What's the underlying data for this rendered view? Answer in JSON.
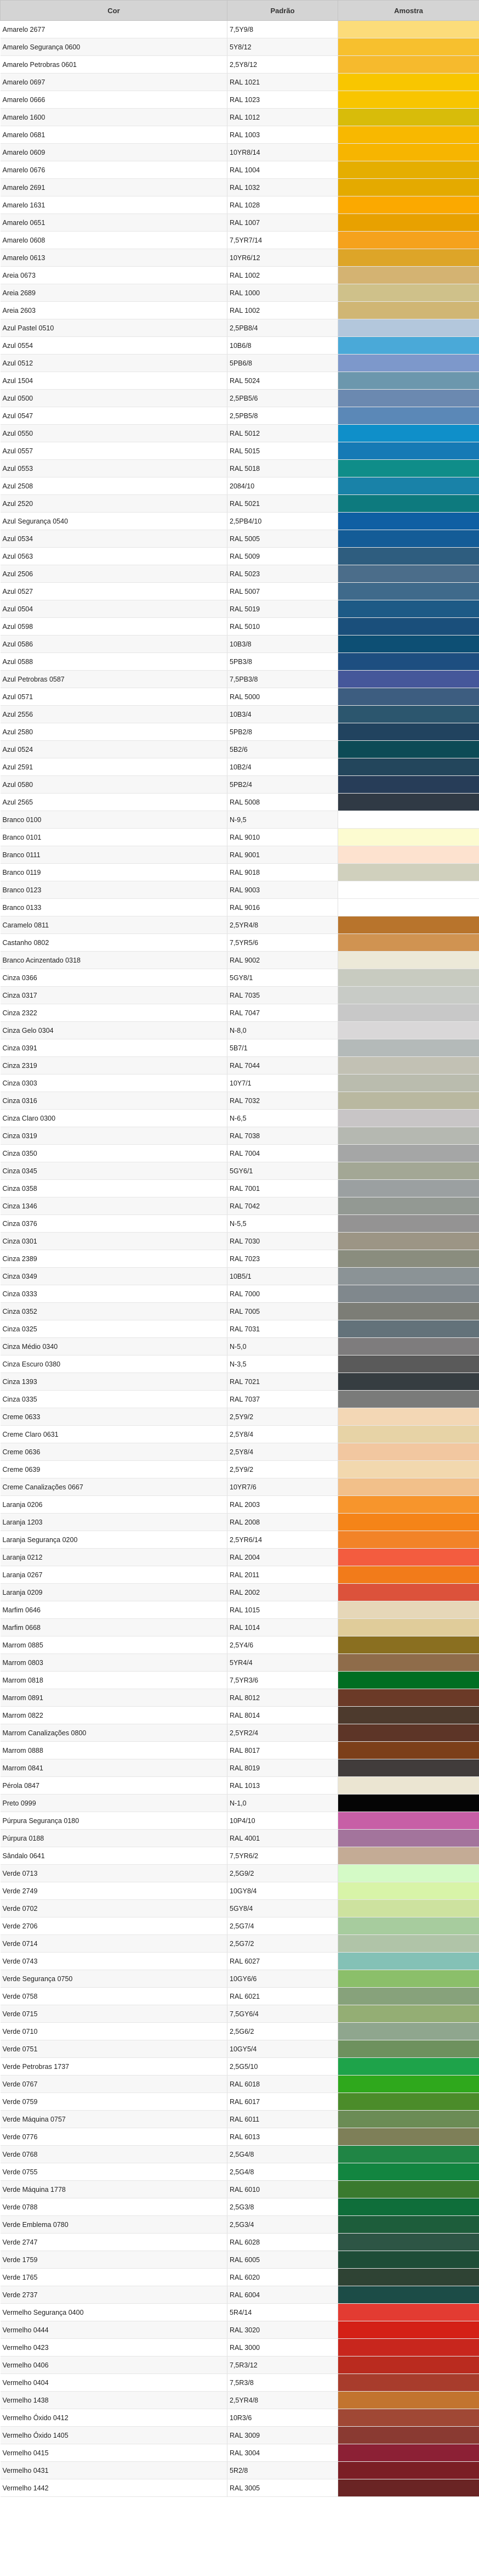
{
  "headers": {
    "cor": "Cor",
    "padrao": "Padrão",
    "amostra": "Amostra"
  },
  "rows": [
    {
      "cor": "Amarelo 2677",
      "padrao": "7,5Y9/8",
      "color": "#fcdc7a"
    },
    {
      "cor": "Amarelo Segurança 0600",
      "padrao": "5Y8/12",
      "color": "#f7c02e"
    },
    {
      "cor": "Amarelo Petrobras 0601",
      "padrao": "2,5Y8/12",
      "color": "#f6ba2d"
    },
    {
      "cor": "Amarelo 0697",
      "padrao": "RAL 1021",
      "color": "#f8c600"
    },
    {
      "cor": "Amarelo 0666",
      "padrao": "RAL 1023",
      "color": "#f8c500"
    },
    {
      "cor": "Amarelo 1600",
      "padrao": "RAL 1012",
      "color": "#d8bc0a"
    },
    {
      "cor": "Amarelo 0681",
      "padrao": "RAL 1003",
      "color": "#f8b800"
    },
    {
      "cor": "Amarelo 0609",
      "padrao": "10YR8/14",
      "color": "#f7b500"
    },
    {
      "cor": "Amarelo 0676",
      "padrao": "RAL 1004",
      "color": "#e5ae00"
    },
    {
      "cor": "Amarelo 2691",
      "padrao": "RAL 1032",
      "color": "#e4aa00"
    },
    {
      "cor": "Amarelo 1631",
      "padrao": "RAL 1028",
      "color": "#fba900"
    },
    {
      "cor": "Amarelo 0651",
      "padrao": "RAL 1007",
      "color": "#e8a100"
    },
    {
      "cor": "Amarelo 0608",
      "padrao": "7,5YR7/14",
      "color": "#f5a21c"
    },
    {
      "cor": "Amarelo 0613",
      "padrao": "10YR6/12",
      "color": "#dda528"
    },
    {
      "cor": "Areia 0673",
      "padrao": "RAL 1002",
      "color": "#d4b372"
    },
    {
      "cor": "Areia 2689",
      "padrao": "RAL 1000",
      "color": "#cfc18a"
    },
    {
      "cor": "Areia 2603",
      "padrao": "RAL 1002",
      "color": "#d0b674"
    },
    {
      "cor": "Azul Pastel 0510",
      "padrao": "2,5PB8/4",
      "color": "#b3c7dc"
    },
    {
      "cor": "Azul 0554",
      "padrao": "10B6/8",
      "color": "#4aa9d8"
    },
    {
      "cor": "Azul 0512",
      "padrao": "5PB6/8",
      "color": "#7d98cb"
    },
    {
      "cor": "Azul 1504",
      "padrao": "RAL 5024",
      "color": "#6c97ad"
    },
    {
      "cor": "Azul 0500",
      "padrao": "2,5PB5/6",
      "color": "#6b89b0"
    },
    {
      "cor": "Azul 0547",
      "padrao": "2,5PB5/8",
      "color": "#5b88b7"
    },
    {
      "cor": "Azul 0550",
      "padrao": "RAL 5012",
      "color": "#0f8fc9"
    },
    {
      "cor": "Azul 0557",
      "padrao": "RAL 5015",
      "color": "#167ab5"
    },
    {
      "cor": "Azul 0553",
      "padrao": "RAL 5018",
      "color": "#0f8d89"
    },
    {
      "cor": "Azul 2508",
      "padrao": "2084/10",
      "color": "#1982a8"
    },
    {
      "cor": "Azul 2520",
      "padrao": "RAL 5021",
      "color": "#0d7a7e"
    },
    {
      "cor": "Azul Segurança 0540",
      "padrao": "2,5PB4/10",
      "color": "#0f5fa3"
    },
    {
      "cor": "Azul 0534",
      "padrao": "RAL 5005",
      "color": "#145c97"
    },
    {
      "cor": "Azul 0563",
      "padrao": "RAL 5009",
      "color": "#2e5d7f"
    },
    {
      "cor": "Azul 2506",
      "padrao": "RAL 5023",
      "color": "#4b6d8a"
    },
    {
      "cor": "Azul 0527",
      "padrao": "RAL 5007",
      "color": "#3f6a8b"
    },
    {
      "cor": "Azul 0504",
      "padrao": "RAL 5019",
      "color": "#1d5a86"
    },
    {
      "cor": "Azul 0598",
      "padrao": "RAL 5010",
      "color": "#1a4f7b"
    },
    {
      "cor": "Azul 0586",
      "padrao": "10B3/8",
      "color": "#0d4f74"
    },
    {
      "cor": "Azul 0588",
      "padrao": "5PB3/8",
      "color": "#1d4e80"
    },
    {
      "cor": "Azul Petrobras 0587",
      "padrao": "7,5PB3/8",
      "color": "#45579a"
    },
    {
      "cor": "Azul 0571",
      "padrao": "RAL 5000",
      "color": "#3d5d80"
    },
    {
      "cor": "Azul 2556",
      "padrao": "10B3/4",
      "color": "#2c566e"
    },
    {
      "cor": "Azul 2580",
      "padrao": "5PB2/8",
      "color": "#21435f"
    },
    {
      "cor": "Azul 0524",
      "padrao": "5B2/6",
      "color": "#0d4b56"
    },
    {
      "cor": "Azul 2591",
      "padrao": "10B2/4",
      "color": "#23465c"
    },
    {
      "cor": "Azul 0580",
      "padrao": "5PB2/4",
      "color": "#273d58"
    },
    {
      "cor": "Azul 2565",
      "padrao": "RAL 5008",
      "color": "#303a45"
    },
    {
      "cor": "Branco 0100",
      "padrao": "N-9,5",
      "color": "#ffffff"
    },
    {
      "cor": "Branco 0101",
      "padrao": "RAL 9010",
      "color": "#fcfbd0"
    },
    {
      "cor": "Branco 0111",
      "padrao": "RAL 9001",
      "color": "#fde2cf"
    },
    {
      "cor": "Branco 0119",
      "padrao": "RAL 9018",
      "color": "#d0d0bd"
    },
    {
      "cor": "Branco 0123",
      "padrao": "RAL 9003",
      "color": "#ffffff"
    },
    {
      "cor": "Branco 0133",
      "padrao": "RAL 9016",
      "color": "#ffffff"
    },
    {
      "cor": "Caramelo 0811",
      "padrao": "2,5YR4/8",
      "color": "#b8742c"
    },
    {
      "cor": "Castanho 0802",
      "padrao": "7,5YR5/6",
      "color": "#d09351"
    },
    {
      "cor": "Branco Acinzentado 0318",
      "padrao": "RAL 9002",
      "color": "#ece9d8"
    },
    {
      "cor": "Cinza 0366",
      "padrao": "5GY8/1",
      "color": "#c8cbc0"
    },
    {
      "cor": "Cinza 0317",
      "padrao": "RAL 7035",
      "color": "#c8cbc6"
    },
    {
      "cor": "Cinza 2322",
      "padrao": "RAL 7047",
      "color": "#c8c8c8"
    },
    {
      "cor": "Cinza Gelo 0304",
      "padrao": "N-8,0",
      "color": "#d9d7d8"
    },
    {
      "cor": "Cinza 0391",
      "padrao": "5B7/1",
      "color": "#b4bab9"
    },
    {
      "cor": "Cinza 2319",
      "padrao": "RAL 7044",
      "color": "#c2c1b4"
    },
    {
      "cor": "Cinza 0303",
      "padrao": "10Y7/1",
      "color": "#babcae"
    },
    {
      "cor": "Cinza 0316",
      "padrao": "RAL 7032",
      "color": "#b9b8a0"
    },
    {
      "cor": "Cinza Claro 0300",
      "padrao": "N-6,5",
      "color": "#c8c5c6"
    },
    {
      "cor": "Cinza 0319",
      "padrao": "RAL 7038",
      "color": "#b5b8b1"
    },
    {
      "cor": "Cinza 0350",
      "padrao": "RAL 7004",
      "color": "#a5a6a6"
    },
    {
      "cor": "Cinza 0345",
      "padrao": "5GY6/1",
      "color": "#a3a795"
    },
    {
      "cor": "Cinza 0358",
      "padrao": "RAL 7001",
      "color": "#9ba0a1"
    },
    {
      "cor": "Cinza 1346",
      "padrao": "RAL 7042",
      "color": "#939993"
    },
    {
      "cor": "Cinza 0376",
      "padrao": "N-5,5",
      "color": "#949393"
    },
    {
      "cor": "Cinza 0301",
      "padrao": "RAL 7030",
      "color": "#9c9585"
    },
    {
      "cor": "Cinza 2389",
      "padrao": "RAL 7023",
      "color": "#8a8d7e"
    },
    {
      "cor": "Cinza 0349",
      "padrao": "10B5/1",
      "color": "#8b9396"
    },
    {
      "cor": "Cinza 0333",
      "padrao": "RAL 7000",
      "color": "#80888d"
    },
    {
      "cor": "Cinza 0352",
      "padrao": "RAL 7005",
      "color": "#7c7d76"
    },
    {
      "cor": "Cinza 0325",
      "padrao": "RAL 7031",
      "color": "#63727a"
    },
    {
      "cor": "Cinza Médio 0340",
      "padrao": "N-5,0",
      "color": "#7e7c7d"
    },
    {
      "cor": "Cinza Escuro 0380",
      "padrao": "N-3,5",
      "color": "#5a5a5a"
    },
    {
      "cor": "Cinza 1393",
      "padrao": "RAL 7021",
      "color": "#363d41"
    },
    {
      "cor": "Cinza 0335",
      "padrao": "RAL 7037",
      "color": "#7a7b7a"
    },
    {
      "cor": "Creme 0633",
      "padrao": "2,5Y9/2",
      "color": "#f3d7b5"
    },
    {
      "cor": "Creme Claro 0631",
      "padrao": "2,5Y8/4",
      "color": "#e7d3a6"
    },
    {
      "cor": "Creme 0636",
      "padrao": "2,5Y8/4",
      "color": "#f2c7a0"
    },
    {
      "cor": "Creme 0639",
      "padrao": "2,5Y9/2",
      "color": "#f2d8ae"
    },
    {
      "cor": "Creme Canalizações 0667",
      "padrao": "10YR7/6",
      "color": "#f2c08a"
    },
    {
      "cor": "Laranja 0206",
      "padrao": "RAL 2003",
      "color": "#f7952c"
    },
    {
      "cor": "Laranja 1203",
      "padrao": "RAL 2008",
      "color": "#f58418"
    },
    {
      "cor": "Laranja Segurança 0200",
      "padrao": "2,5YR6/14",
      "color": "#f28328"
    },
    {
      "cor": "Laranja 0212",
      "padrao": "RAL 2004",
      "color": "#f35c3f"
    },
    {
      "cor": "Laranja 0267",
      "padrao": "RAL 2011",
      "color": "#f27b1a"
    },
    {
      "cor": "Laranja 0209",
      "padrao": "RAL 2002",
      "color": "#dc523b"
    },
    {
      "cor": "Marfim 0646",
      "padrao": "RAL 1015",
      "color": "#e6d7b8"
    },
    {
      "cor": "Marfim 0668",
      "padrao": "RAL 1014",
      "color": "#e0cc9a"
    },
    {
      "cor": "Marrom 0885",
      "padrao": "2,5Y4/6",
      "color": "#8a6f20"
    },
    {
      "cor": "Marrom 0803",
      "padrao": "5YR4/4",
      "color": "#8f6c4a"
    },
    {
      "cor": "Marrom 0818",
      "padrao": "7,5YR3/6",
      "color": "#006e22"
    },
    {
      "cor": "Marrom 0891",
      "padrao": "RAL 8012",
      "color": "#6b3a27"
    },
    {
      "cor": "Marrom 0822",
      "padrao": "RAL 8014",
      "color": "#4d3a2d"
    },
    {
      "cor": "Marrom Canalizações 0800",
      "padrao": "2,5YR2/4",
      "color": "#5d3527"
    },
    {
      "cor": "Marrom 0888",
      "padrao": "RAL 8017",
      "color": "#7c3f19"
    },
    {
      "cor": "Marrom 0841",
      "padrao": "RAL 8019",
      "color": "#413c3b"
    },
    {
      "cor": "Pérola 0847",
      "padrao": "RAL 1013",
      "color": "#ebe5d2"
    },
    {
      "cor": "Preto 0999",
      "padrao": "N-1,0",
      "color": "#050505"
    },
    {
      "cor": "Púrpura Segurança 0180",
      "padrao": "10P4/10",
      "color": "#c75fa6"
    },
    {
      "cor": "Púrpura 0188",
      "padrao": "RAL 4001",
      "color": "#a3749c"
    },
    {
      "cor": "Sândalo 0641",
      "padrao": "7,5YR6/2",
      "color": "#c4ab95"
    },
    {
      "cor": "Verde 0713",
      "padrao": "2,5G9/2",
      "color": "#d4fac6"
    },
    {
      "cor": "Verde 2749",
      "padrao": "10GY8/4",
      "color": "#d8f4a8"
    },
    {
      "cor": "Verde 0702",
      "padrao": "5GY8/4",
      "color": "#cde29f"
    },
    {
      "cor": "Verde 2706",
      "padrao": "2,5G7/4",
      "color": "#a7cc9e"
    },
    {
      "cor": "Verde 0714",
      "padrao": "2,5G7/2",
      "color": "#b0c4a8"
    },
    {
      "cor": "Verde 0743",
      "padrao": "RAL 6027",
      "color": "#84c1b6"
    },
    {
      "cor": "Verde Segurança 0750",
      "padrao": "10GY6/6",
      "color": "#8bbf6a"
    },
    {
      "cor": "Verde 0758",
      "padrao": "RAL 6021",
      "color": "#87a27b"
    },
    {
      "cor": "Verde 0715",
      "padrao": "7,5GY6/4",
      "color": "#94ae74"
    },
    {
      "cor": "Verde 0710",
      "padrao": "2,5G6/2",
      "color": "#8fa68e"
    },
    {
      "cor": "Verde 0751",
      "padrao": "10GY5/4",
      "color": "#6e915e"
    },
    {
      "cor": "Verde Petrobras 1737",
      "padrao": "2,5G5/10",
      "color": "#1ea34a"
    },
    {
      "cor": "Verde 0767",
      "padrao": "RAL 6018",
      "color": "#2fa81c"
    },
    {
      "cor": "Verde 0759",
      "padrao": "RAL 6017",
      "color": "#4b8c2a"
    },
    {
      "cor": "Verde Máquina 0757",
      "padrao": "RAL 6011",
      "color": "#6b8c55"
    },
    {
      "cor": "Verde 0776",
      "padrao": "RAL 6013",
      "color": "#7e7f58"
    },
    {
      "cor": "Verde 0768",
      "padrao": "2,5G4/8",
      "color": "#208545"
    },
    {
      "cor": "Verde 0755",
      "padrao": "2,5G4/8",
      "color": "#128540"
    },
    {
      "cor": "Verde Máquina 1778",
      "padrao": "RAL 6010",
      "color": "#3a7a2e"
    },
    {
      "cor": "Verde 0788",
      "padrao": "2,5G3/8",
      "color": "#0f6e3a"
    },
    {
      "cor": "Verde Emblema 0780",
      "padrao": "2,5G3/4",
      "color": "#1d5d3b"
    },
    {
      "cor": "Verde 2747",
      "padrao": "RAL 6028",
      "color": "#2d5545"
    },
    {
      "cor": "Verde 1759",
      "padrao": "RAL 6005",
      "color": "#1e4d37"
    },
    {
      "cor": "Verde 1765",
      "padrao": "RAL 6020",
      "color": "#2f4334"
    },
    {
      "cor": "Verde 2737",
      "padrao": "RAL 6004",
      "color": "#1c4c47"
    },
    {
      "cor": "Vermelho Segurança 0400",
      "padrao": "5R4/14",
      "color": "#e33b32"
    },
    {
      "cor": "Vermelho 0444",
      "padrao": "RAL 3020",
      "color": "#d42016"
    },
    {
      "cor": "Vermelho 0423",
      "padrao": "RAL 3000",
      "color": "#c8261d"
    },
    {
      "cor": "Vermelho 0406",
      "padrao": "7,5R3/12",
      "color": "#ba2b1f"
    },
    {
      "cor": "Vermelho 0404",
      "padrao": "7,5R3/8",
      "color": "#a83c2c"
    },
    {
      "cor": "Vermelho 1438",
      "padrao": "2,5YR4/8",
      "color": "#c2742f"
    },
    {
      "cor": "Vermelho Óxido 0412",
      "padrao": "10R3/6",
      "color": "#a04835"
    },
    {
      "cor": "Vermelho Óxido 1405",
      "padrao": "RAL 3009",
      "color": "#8a3a32"
    },
    {
      "cor": "Vermelho 0415",
      "padrao": "RAL 3004",
      "color": "#8c2035"
    },
    {
      "cor": "Vermelho 0431",
      "padrao": "5R2/8",
      "color": "#7b1e25"
    },
    {
      "cor": "Vermelho 1442",
      "padrao": "RAL 3005",
      "color": "#6a2424"
    }
  ]
}
